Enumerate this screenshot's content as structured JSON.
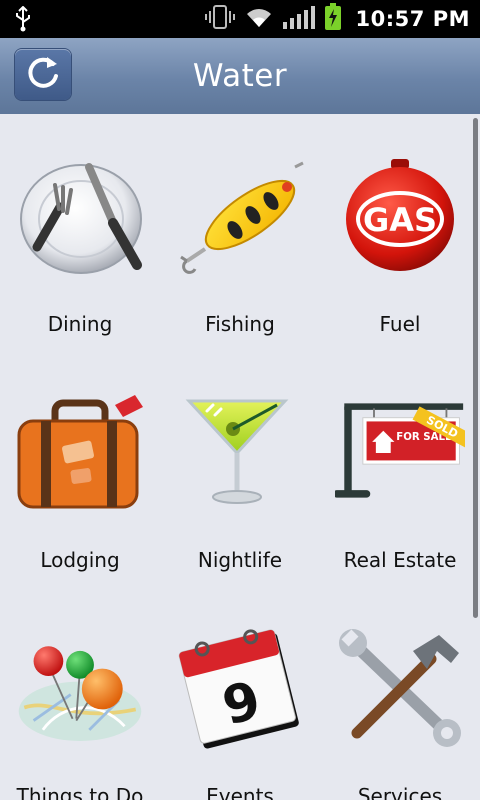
{
  "status_bar": {
    "time": "10:57 PM",
    "icons": [
      "usb-icon",
      "vibrate-icon",
      "wifi-icon",
      "signal-icon",
      "battery-charging-icon"
    ]
  },
  "header": {
    "title": "Water",
    "refresh_icon": "refresh-icon"
  },
  "grid": {
    "items": [
      {
        "label": "Dining",
        "icon": "dining-icon"
      },
      {
        "label": "Fishing",
        "icon": "fishing-lure-icon"
      },
      {
        "label": "Fuel",
        "icon": "gas-icon"
      },
      {
        "label": "Lodging",
        "icon": "suitcase-icon"
      },
      {
        "label": "Nightlife",
        "icon": "cocktail-icon"
      },
      {
        "label": "Real Estate",
        "icon": "for-sale-sign-icon"
      },
      {
        "label": "Things to Do",
        "icon": "map-pins-icon"
      },
      {
        "label": "Events",
        "icon": "calendar-icon"
      },
      {
        "label": "Services",
        "icon": "tools-icon"
      }
    ],
    "gas_sign_text": "GAS",
    "real_estate_sign_text": "FOR SALE",
    "sold_banner_text": "SOLD",
    "calendar_day": "9"
  }
}
